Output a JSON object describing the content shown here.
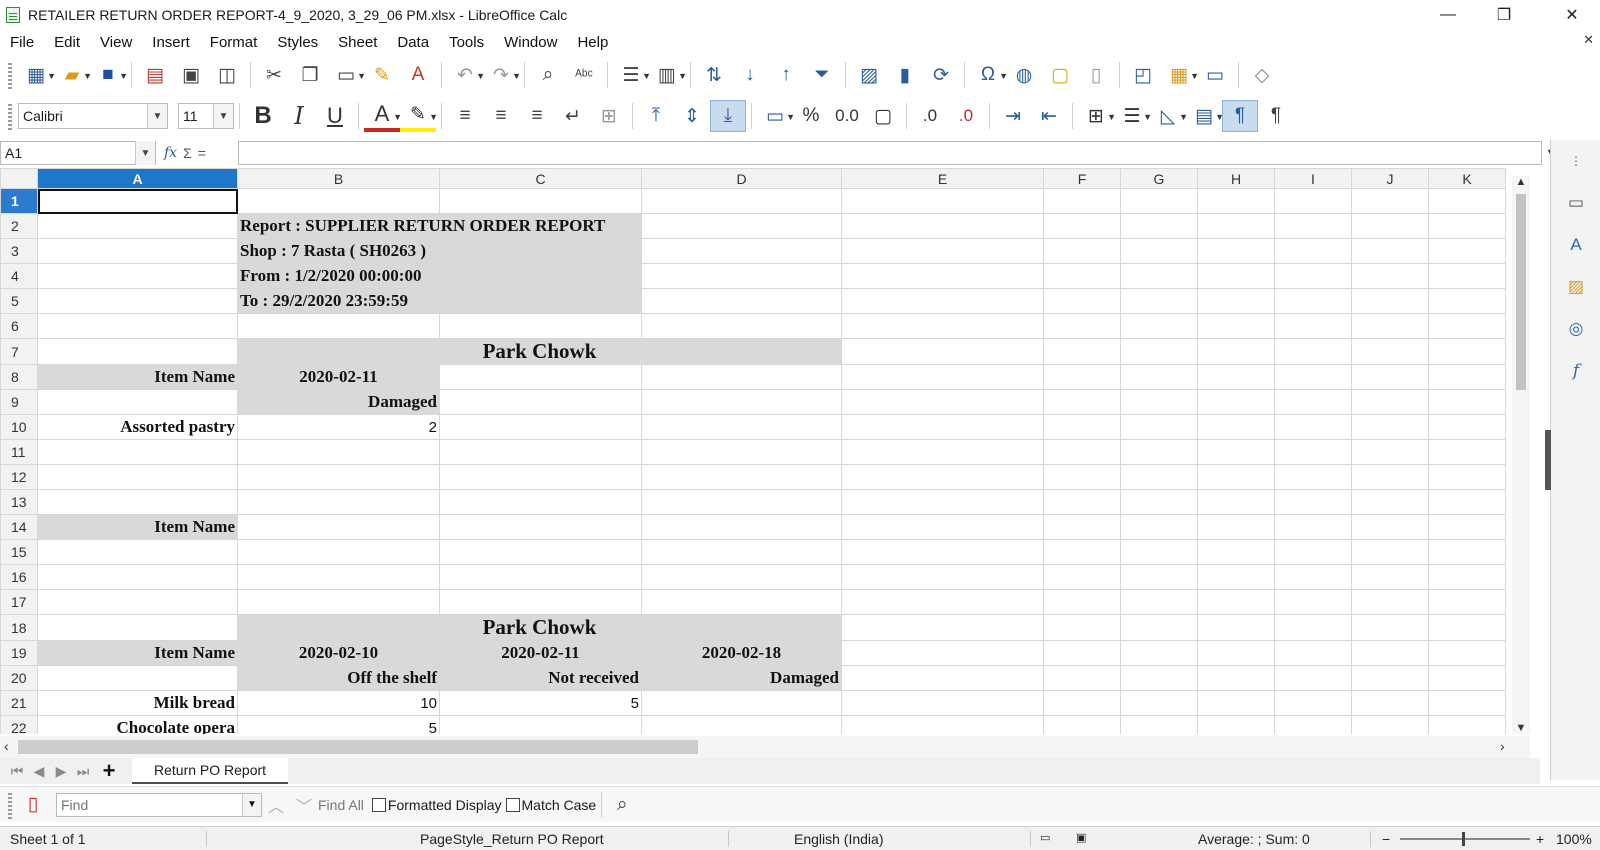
{
  "window": {
    "title": "RETAILER RETURN ORDER REPORT-4_9_2020, 3_29_06 PM.xlsx - LibreOffice Calc",
    "minimize": "—",
    "maximize": "❐",
    "close": "✕"
  },
  "menu": {
    "items": [
      "File",
      "Edit",
      "View",
      "Insert",
      "Format",
      "Styles",
      "Sheet",
      "Data",
      "Tools",
      "Window",
      "Help"
    ],
    "close_doc": "✕"
  },
  "formatting": {
    "font_name": "Calibri",
    "font_size": "11"
  },
  "formula_bar": {
    "name_box": "A1",
    "fx": "fx",
    "sum": "Σ",
    "equals": "=",
    "content": ""
  },
  "grid": {
    "columns": [
      "A",
      "B",
      "C",
      "D",
      "E",
      "F",
      "G",
      "H",
      "I",
      "J",
      "K"
    ],
    "rows": [
      "1",
      "2",
      "3",
      "4",
      "5",
      "6",
      "7",
      "8",
      "9",
      "10",
      "11",
      "12",
      "13",
      "14",
      "15",
      "16",
      "17",
      "18",
      "19",
      "20",
      "21",
      "22"
    ],
    "cells": {
      "B2": "Report : SUPPLIER RETURN ORDER REPORT",
      "B3": "Shop : 7 Rasta ( SH0263 )",
      "B4": "From : 1/2/2020 00:00:00",
      "B5": "To : 29/2/2020 23:59:59",
      "B7": "Park Chowk",
      "A8": "Item Name",
      "B8": "2020-02-11",
      "B9": "Damaged",
      "A10": "Assorted pastry",
      "B10": "2",
      "A14": "Item Name",
      "B18": "Park Chowk",
      "A19": "Item Name",
      "B19": "2020-02-10",
      "C19": "2020-02-11",
      "D19": "2020-02-18",
      "B20": "Off the shelf",
      "C20": "Not received",
      "D20": "Damaged",
      "A21": "Milk bread",
      "B21": "10",
      "C21": "5",
      "A22": "Chocolate opera",
      "B22": "5"
    }
  },
  "sheet_tabs": {
    "active": "Return PO Report",
    "add": "+"
  },
  "find_bar": {
    "placeholder": "Find",
    "find_all": "Find All",
    "formatted_display": "Formatted Display",
    "match_case": "Match Case"
  },
  "status": {
    "sheet": "Sheet 1 of 1",
    "page_style": "PageStyle_Return PO Report",
    "language": "English (India)",
    "summary": "Average: ; Sum: 0",
    "zoom_minus": "−",
    "zoom_plus": "+",
    "zoom": "100%"
  }
}
